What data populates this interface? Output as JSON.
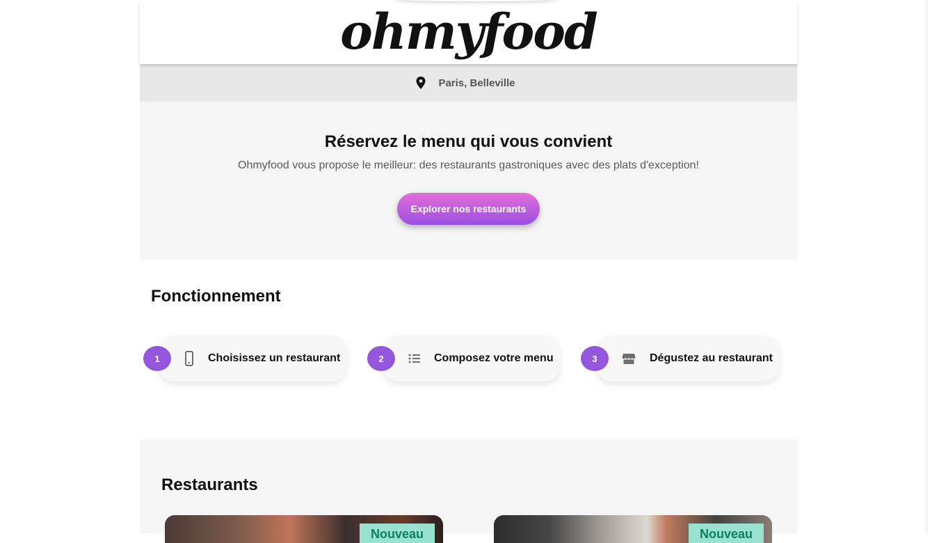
{
  "header": {
    "logo": "ohmyfood",
    "location": "Paris, Belleville"
  },
  "hero": {
    "title": "Réservez le menu qui vous convient",
    "subtitle": "Ohmyfood vous propose le meilleur: des restaurants gastroniques avec des plats d'exception!",
    "cta_label": "Explorer nos restaurants"
  },
  "how": {
    "title": "Fonctionnement",
    "steps": [
      {
        "number": "1",
        "label": "Choisissez un restaurant",
        "icon": "mobile-phone-icon"
      },
      {
        "number": "2",
        "label": "Composez votre menu",
        "icon": "list-icon"
      },
      {
        "number": "3",
        "label": "Dégustez au restaurant",
        "icon": "store-icon"
      }
    ]
  },
  "restaurants": {
    "title": "Restaurants",
    "cards": [
      {
        "badge": "Nouveau"
      },
      {
        "badge": "Nouveau"
      }
    ]
  },
  "colors": {
    "accent_purple": "#9356dc",
    "accent_pink": "#e46fd9",
    "badge_bg": "#99e2d0",
    "badge_text": "#0b8063"
  }
}
